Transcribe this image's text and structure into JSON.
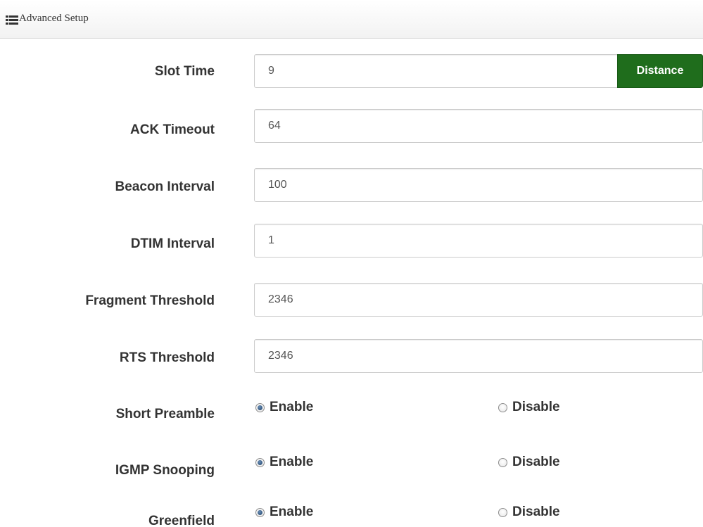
{
  "panel": {
    "title": "Advanced Setup",
    "icon": "list-icon"
  },
  "fields": {
    "slot_time": {
      "label": "Slot Time",
      "value": "9",
      "button_label": "Distance"
    },
    "ack_timeout": {
      "label": "ACK Timeout",
      "value": "64"
    },
    "beacon_interval": {
      "label": "Beacon Interval",
      "value": "100"
    },
    "dtim_interval": {
      "label": "DTIM Interval",
      "value": "1"
    },
    "fragment_threshold": {
      "label": "Fragment Threshold",
      "value": "2346"
    },
    "rts_threshold": {
      "label": "RTS Threshold",
      "value": "2346"
    }
  },
  "radios": {
    "short_preamble": {
      "label": "Short Preamble",
      "enable_label": "Enable",
      "disable_label": "Disable",
      "selected": "Enable"
    },
    "igmp_snooping": {
      "label": "IGMP Snooping",
      "enable_label": "Enable",
      "disable_label": "Disable",
      "selected": "Enable"
    },
    "greenfield": {
      "label": "Greenfield",
      "enable_label": "Enable",
      "disable_label": "Disable",
      "selected": "Enable"
    }
  },
  "colors": {
    "button_green": "#1f6d1c",
    "radio_dot": "#1d3f66"
  }
}
